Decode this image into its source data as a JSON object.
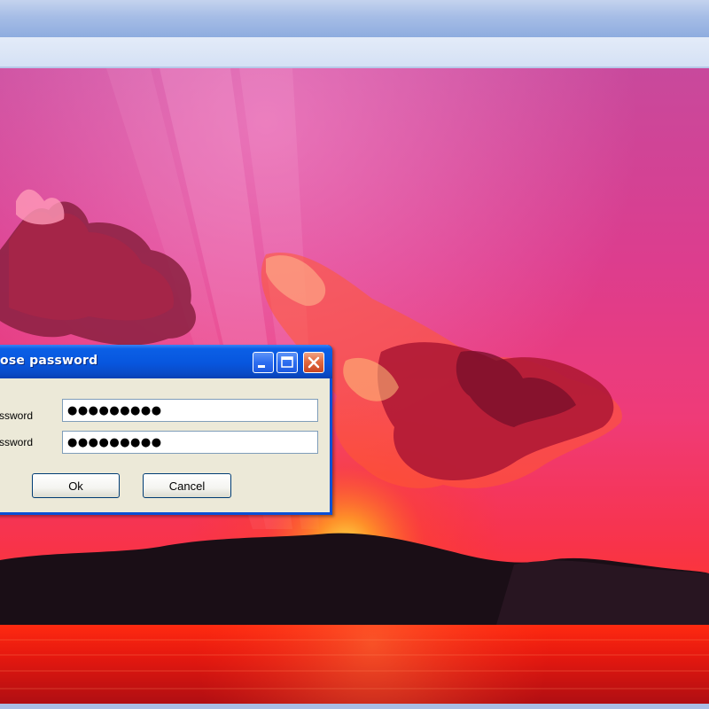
{
  "colors": {
    "sky_top": "#c8499c",
    "sky_mid": "#ef3b78",
    "horizon": "#ff3a1e",
    "sun": "#ffd23a",
    "mountains": "#1a0e16",
    "water": "#d8140f",
    "dialog_title_blue": "#0756de",
    "close_button_red": "#e26a3f",
    "dialog_face": "#ece9d8"
  },
  "dialog": {
    "title": "ose password",
    "password_label": "assword",
    "confirm_label": "password",
    "password_value": "●●●●●●●●●",
    "confirm_value": "●●●●●●●●●",
    "ok_label": "Ok",
    "cancel_label": "Cancel",
    "icons": {
      "minimize": "minimize-icon",
      "maximize": "maximize-icon",
      "close": "close-icon"
    }
  }
}
